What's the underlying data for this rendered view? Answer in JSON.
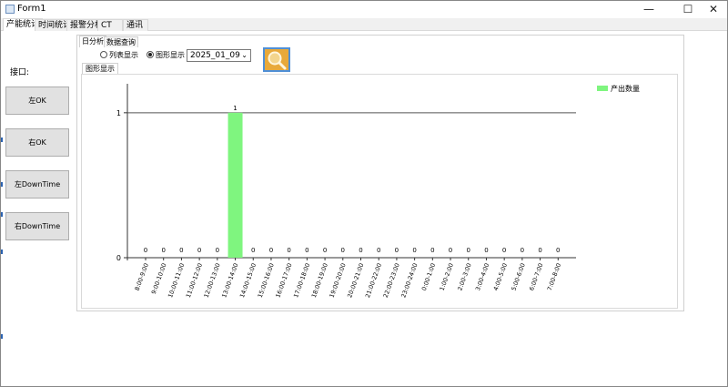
{
  "window": {
    "title": "Form1",
    "minimize": "—",
    "maximize": "☐",
    "close": "✕"
  },
  "main_tabs": [
    "产能统计",
    "时间统计",
    "报警分析",
    "CT",
    "通讯"
  ],
  "sidebar": {
    "port_label": "接口:",
    "buttons": [
      "左OK",
      "右OK",
      "左DownTime",
      "右DownTime"
    ]
  },
  "sub_tabs": [
    "日分析",
    "数据查询"
  ],
  "view_options": {
    "list_label": "列表显示",
    "graph_label": "图形显示",
    "selected": "图形显示"
  },
  "date": {
    "value": "2025_01_09"
  },
  "graph_tab": "图形显示",
  "colors": {
    "bar": "#7ff57f",
    "accent_search": "#e8a93a"
  },
  "chart_data": {
    "type": "bar",
    "categories": [
      "8:00-9:00",
      "9:00-10:00",
      "10:00-11:00",
      "11:00-12:00",
      "12:00-13:00",
      "13:00-14:00",
      "14:00-15:00",
      "15:00-16:00",
      "16:00-17:00",
      "17:00-18:00",
      "18:00-19:00",
      "19:00-20:00",
      "20:00-21:00",
      "21:00-22:00",
      "22:00-23:00",
      "23:00-24:00",
      "0:00-1:00",
      "1:00-2:00",
      "2:00-3:00",
      "3:00-4:00",
      "4:00-5:00",
      "5:00-6:00",
      "6:00-7:00",
      "7:00-8:00"
    ],
    "series": [
      {
        "name": "产出数量",
        "values": [
          0,
          0,
          0,
          0,
          0,
          1,
          0,
          0,
          0,
          0,
          0,
          0,
          0,
          0,
          0,
          0,
          0,
          0,
          0,
          0,
          0,
          0,
          0,
          0
        ]
      }
    ],
    "yticks": [
      "0",
      "1"
    ],
    "ylim": [
      0,
      1.2
    ],
    "legend": "top-right",
    "grid": false
  }
}
